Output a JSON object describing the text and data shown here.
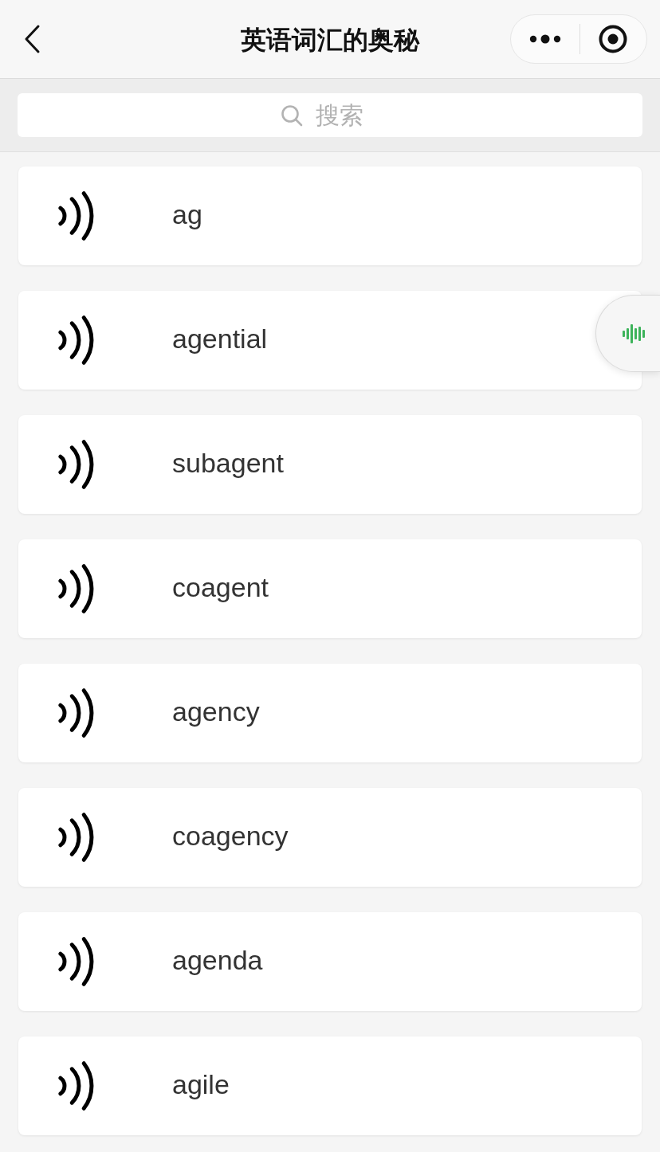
{
  "header": {
    "title": "英语词汇的奥秘"
  },
  "search": {
    "placeholder": "搜索"
  },
  "words": [
    {
      "text": "ag"
    },
    {
      "text": "agential"
    },
    {
      "text": "subagent"
    },
    {
      "text": "coagent"
    },
    {
      "text": "agency"
    },
    {
      "text": "coagency"
    },
    {
      "text": "agenda"
    },
    {
      "text": "agile"
    }
  ]
}
